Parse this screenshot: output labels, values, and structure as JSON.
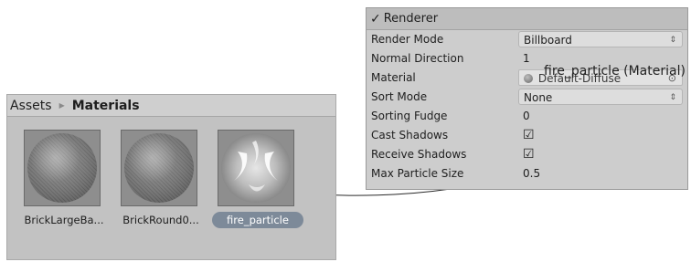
{
  "project": {
    "breadcrumb": {
      "root": "Assets",
      "current": "Materials"
    },
    "assets": [
      {
        "label": "BrickLargeBa...",
        "selected": false
      },
      {
        "label": "BrickRound0...",
        "selected": false
      },
      {
        "label": "fire_particle",
        "selected": true
      }
    ]
  },
  "inspector": {
    "component_title": "Renderer",
    "enabled": true,
    "properties": [
      {
        "label": "Render Mode",
        "value": "Billboard",
        "kind": "dropdown"
      },
      {
        "label": "Normal Direction",
        "value": "1",
        "kind": "number"
      },
      {
        "label": "Material",
        "value": "Default-Diffuse",
        "kind": "object"
      },
      {
        "label": "Sort Mode",
        "value": "None",
        "kind": "dropdown"
      },
      {
        "label": "Sorting Fudge",
        "value": "0",
        "kind": "number"
      },
      {
        "label": "Cast Shadows",
        "value": true,
        "kind": "checkbox"
      },
      {
        "label": "Receive Shadows",
        "value": true,
        "kind": "checkbox"
      },
      {
        "label": "Max Particle Size",
        "value": "0.5",
        "kind": "number"
      }
    ]
  },
  "drag": {
    "tooltip": "fire_particle (Material)"
  },
  "icons": {
    "breadcrumb_separator": "triangle-right-icon",
    "dropdown_arrows": "up-down-arrows-icon",
    "object_picker": "target-circle-icon",
    "check": "checkmark-icon"
  }
}
